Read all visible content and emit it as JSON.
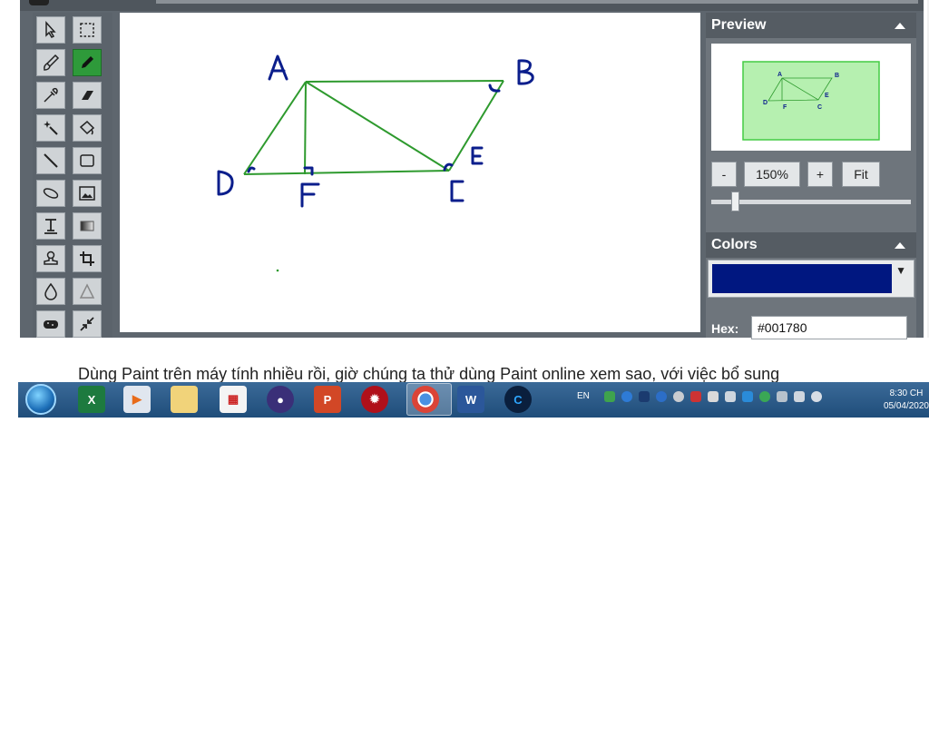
{
  "panels": {
    "preview_title": "Preview",
    "colors_title": "Colors",
    "zoom_out_label": "-",
    "zoom_value": "150%",
    "zoom_in_label": "+",
    "fit_label": "Fit",
    "slider_value_fraction": 0.1,
    "hex_label": "Hex:",
    "hex_value": "#001780",
    "selected_color": "#001780",
    "swatch_arrow": "▼"
  },
  "canvas": {
    "labels": [
      "A",
      "B",
      "C",
      "D",
      "E",
      "F"
    ],
    "line_color": "#2e9a2e",
    "label_color": "#0b1e8c",
    "preview_fill": "#b6f0b0"
  },
  "article": {
    "caption": "Dùng Paint trên máy tính nhiều rồi, giờ chúng ta thử dùng Paint online xem sao, với việc bổ sung"
  },
  "taskbar": {
    "apps": [
      "excel-icon",
      "media-player-icon",
      "file-explorer-icon",
      "app-grid-icon",
      "teams-icon",
      "powerpoint-icon",
      "security-icon",
      "chrome-icon",
      "word-icon",
      "ccleaner-icon"
    ],
    "lang": "EN",
    "time": "8:30 CH",
    "date": "05/04/2020"
  },
  "toolbox": {
    "tools": [
      "select-arrow-icon",
      "rect-select-icon",
      "brush-icon",
      "pencil-icon",
      "color-picker-icon",
      "eraser-icon",
      "magic-wand-icon",
      "fill-bucket-icon",
      "line-icon",
      "rectangle-icon",
      "ellipse-icon",
      "image-icon",
      "text-icon",
      "gradient-icon",
      "stamp-icon",
      "crop-icon",
      "blur-icon",
      "sharpen-icon",
      "sponge-icon",
      "shrink-icon"
    ],
    "active_tool": "pencil-icon"
  }
}
